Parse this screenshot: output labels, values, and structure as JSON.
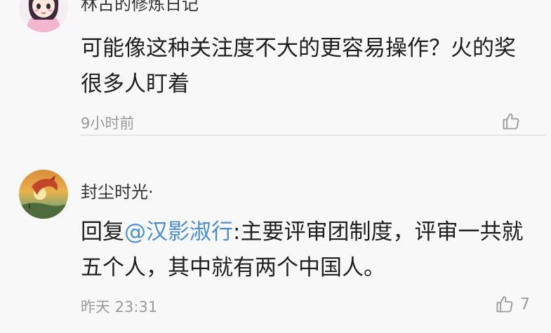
{
  "comments": [
    {
      "username": "林古的修炼日记",
      "avatar_icon": "cartoon-girl-avatar",
      "text": "可能像这种关注度不大的更容易操作？火的奖很多人盯着",
      "time": "9小时前",
      "like_count": ""
    },
    {
      "username": "封尘时光·",
      "avatar_icon": "sunset-dragon-avatar",
      "reply_prefix": "回复",
      "mention": "@汉影淑行",
      "text": ":主要评审团制度，评审一共就五个人，其中就有两个中国人。",
      "time": "昨天 23:31",
      "like_count": "7"
    }
  ],
  "colors": {
    "background": "#f8f8f8",
    "mention": "#4a8fd0",
    "meta": "#9a9a9a",
    "divider": "#e5e5e5"
  }
}
